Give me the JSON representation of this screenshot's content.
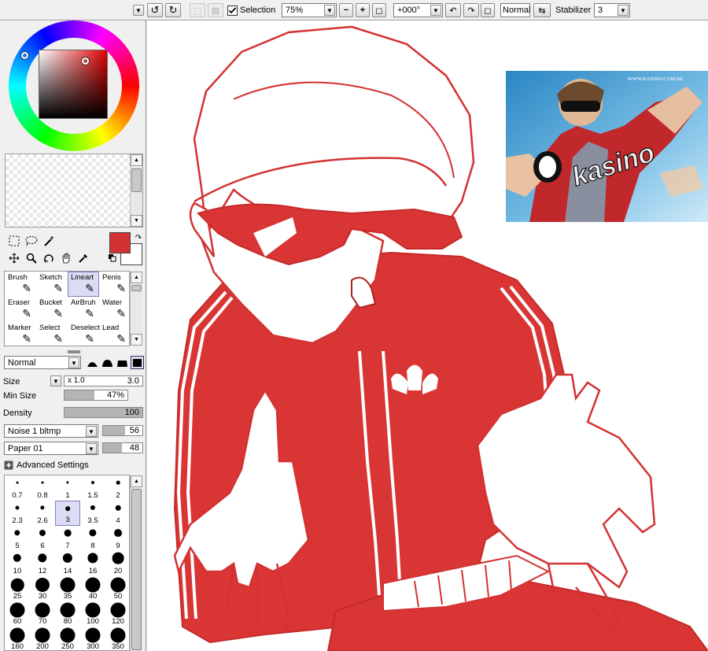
{
  "toolbar": {
    "selection_label": "Selection",
    "zoom_value": "75%",
    "rotation_value": "+000°",
    "blend_mode": "Normal",
    "stabilizer_label": "Stabilizer",
    "stabilizer_value": "3"
  },
  "panel_tabs": [
    "color-wheel",
    "rgb-sliders",
    "hsv-sliders",
    "grayscale",
    "palette",
    "swatches"
  ],
  "colors": {
    "foreground": "#d33232",
    "background": "#ffffff",
    "canvas_red": "#d93535"
  },
  "brushes": [
    {
      "label": "Brush",
      "icon": "brush-icon"
    },
    {
      "label": "Sketch",
      "icon": "pencil-icon"
    },
    {
      "label": "Lineart",
      "icon": "pen-icon",
      "selected": true
    },
    {
      "label": "Penis",
      "icon": "pen-icon"
    },
    {
      "label": "Eraser",
      "icon": "eraser-icon"
    },
    {
      "label": "Bucket",
      "icon": "bucket-icon"
    },
    {
      "label": "AirBruh",
      "icon": "airbrush-icon"
    },
    {
      "label": "Water",
      "icon": "water-brush-icon"
    },
    {
      "label": "Marker",
      "icon": "marker-icon"
    },
    {
      "label": "Select",
      "icon": "select-brush-icon"
    },
    {
      "label": "Deselect",
      "icon": "deselect-brush-icon"
    },
    {
      "label": "Lead",
      "icon": "pencil-icon"
    }
  ],
  "brush_settings": {
    "blend_mode": "Normal",
    "size_label": "Size",
    "size_multiplier": "x 1.0",
    "size_value": "3.0",
    "min_size_label": "Min Size",
    "min_size_value": "47%",
    "min_size_fraction": 0.47,
    "density_label": "Density",
    "density_value": "100",
    "density_fraction": 1.0,
    "texture_label": "Noise 1 bltmp",
    "texture_value": "56",
    "texture_fraction": 0.56,
    "paper_label": "Paper 01",
    "paper_value": "48",
    "paper_fraction": 0.48,
    "advanced_label": "Advanced Settings"
  },
  "brush_sizes": [
    "0.7",
    "0.8",
    "1",
    "1.5",
    "2",
    "2.3",
    "2.6",
    "3",
    "3.5",
    "4",
    "5",
    "6",
    "7",
    "8",
    "9",
    "10",
    "12",
    "14",
    "16",
    "20",
    "25",
    "30",
    "35",
    "40",
    "50",
    "60",
    "70",
    "80",
    "100",
    "120",
    "160",
    "200",
    "250",
    "300",
    "350"
  ],
  "selected_brush_size": "3",
  "photo": {
    "site_text": "WWW.KASINO.COM.BR",
    "logo_text": "kasino"
  }
}
